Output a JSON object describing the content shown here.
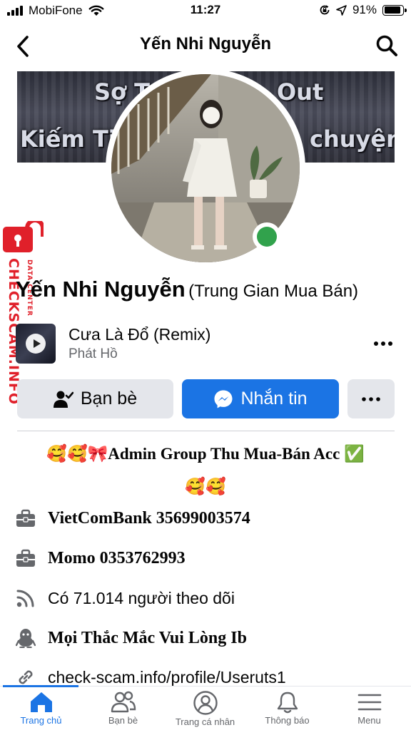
{
  "status_bar": {
    "carrier": "MobiFone",
    "time": "11:27",
    "battery": "91%",
    "battery_level": 0.91
  },
  "header": {
    "title": "Yến Nhi Nguyễn",
    "back_icon": "chevron-left-icon",
    "search_icon": "search-icon"
  },
  "cover": {
    "text_line1_left": "Sợ T",
    "text_line1_right": "Out",
    "text_line2_left": "Kiếm Tiề",
    "text_line2_right": "chuyện"
  },
  "watermark": {
    "text": "CHECKSCAM.INFO",
    "subtext": "DATA CENTER"
  },
  "profile": {
    "name": "Yến Nhi Nguyễn",
    "alternate_name": "(Trung Gian Mua Bán)",
    "online": true
  },
  "music": {
    "title": "Cưa Là Đổ (Remix)",
    "artist": "Phát Hồ"
  },
  "actions": {
    "friends_label": "Bạn bè",
    "message_label": "Nhắn tin",
    "more_label": "•••"
  },
  "bio": {
    "line1": "🥰🥰🎀Admin Group Thu Mua-Bán Acc ✅",
    "line2": "🥰🥰"
  },
  "info": {
    "bank": "VietComBank 35699003574",
    "momo": "Momo 0353762993",
    "followers": "Có 71.014 người theo dõi",
    "contact": "Mọi Thắc Mắc Vui Lòng Ib",
    "link": "check-scam.info/profile/Useruts1"
  },
  "tabs": [
    {
      "label": "Trang chủ",
      "icon": "home-icon",
      "active": true
    },
    {
      "label": "Bạn bè",
      "icon": "friends-icon",
      "active": false
    },
    {
      "label": "Trang cá nhân",
      "icon": "profile-icon",
      "active": false
    },
    {
      "label": "Thông báo",
      "icon": "bell-icon",
      "active": false
    },
    {
      "label": "Menu",
      "icon": "menu-icon",
      "active": false
    }
  ],
  "colors": {
    "accent": "#1b74e4",
    "online": "#31a24c",
    "watermark": "#e0202a",
    "muted": "#65676b"
  }
}
